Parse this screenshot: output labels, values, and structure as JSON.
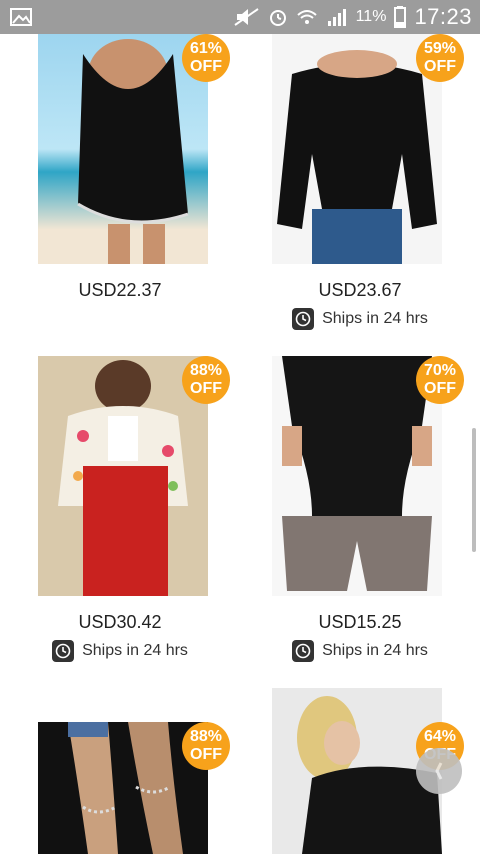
{
  "status_bar": {
    "battery_percent": "11%",
    "time": "17:23",
    "icons": [
      "gallery-icon",
      "mute-icon",
      "alarm-icon",
      "wifi-icon",
      "signal-icon",
      "battery-icon"
    ]
  },
  "products": [
    {
      "discount_pct": "61%",
      "off": "OFF",
      "price": "USD22.37",
      "ships": null
    },
    {
      "discount_pct": "59%",
      "off": "OFF",
      "price": "USD23.67",
      "ships": "Ships in 24 hrs"
    },
    {
      "discount_pct": "88%",
      "off": "OFF",
      "price": "USD30.42",
      "ships": "Ships in 24 hrs"
    },
    {
      "discount_pct": "70%",
      "off": "OFF",
      "price": "USD15.25",
      "ships": "Ships in 24 hrs"
    },
    {
      "discount_pct": "88%",
      "off": "OFF"
    },
    {
      "discount_pct": "64%",
      "off": "OFF"
    }
  ],
  "colors": {
    "badge": "#f7a21b",
    "statusbar": "#9c9c9c"
  }
}
